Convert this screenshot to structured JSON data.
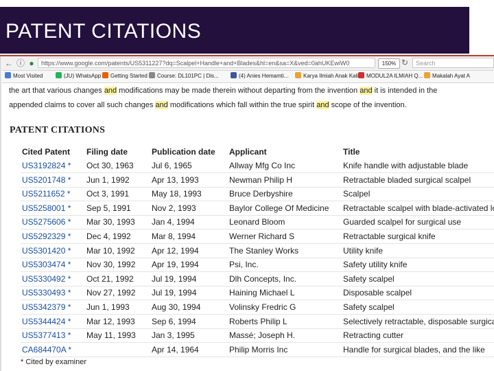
{
  "slide": {
    "title": "PATENT CITATIONS"
  },
  "browser": {
    "url": "https://www.google.com/patents/US5311227?dq=Scalpel+Handle+and+Blades&hl=en&sa=X&ved=0ahUKEwiW0",
    "zoom": "150%",
    "search_placeholder": "Search",
    "bookmarks": [
      {
        "label": "Most Visited",
        "icon_color": "#4a7bd0"
      },
      {
        "label": "(JU) WhatsApp",
        "icon_color": "#25b35a"
      },
      {
        "label": "Getting Started",
        "icon_color": "#e66000"
      },
      {
        "label": "Course: DL101PC | Dis...",
        "icon_color": "#888888"
      },
      {
        "label": "(4) Anies Hemamti...",
        "icon_color": "#3b5998"
      },
      {
        "label": "Karya Ilmiah Anak Kali...",
        "icon_color": "#f0a030"
      },
      {
        "label": "MODUL2A ILMIAH Q...",
        "icon_color": "#d03030"
      },
      {
        "label": "Makalah Ayat A",
        "icon_color": "#f0a030"
      }
    ]
  },
  "paragraph": {
    "line1_a": "the art that various changes ",
    "and1": "and",
    "line1_b": " modifications may be made therein without departing from the invention ",
    "and2": "and",
    "line1_c": " it is intended in the",
    "line2_a": "appended claims to cover all such changes ",
    "and3": "and",
    "line2_b": " modifications which fall within the true spirit ",
    "and4": "and",
    "line2_c": " scope of the invention."
  },
  "section_heading": "PATENT CITATIONS",
  "table": {
    "headers": {
      "cited": "Cited Patent",
      "filing": "Filing date",
      "publication": "Publication date",
      "applicant": "Applicant",
      "title": "Title"
    },
    "rows": [
      {
        "cited": "US3192824 *",
        "filing": "Oct 30, 1963",
        "publication": "Jul 6, 1965",
        "applicant": "Allway Mfg Co Inc",
        "title": "Knife handle with adjustable blade"
      },
      {
        "cited": "US5201748 *",
        "filing": "Jun 1, 1992",
        "publication": "Apr 13, 1993",
        "applicant": "Newman Philip H",
        "title": "Retractable bladed surgical scalpel"
      },
      {
        "cited": "US5211652 *",
        "filing": "Oct 3, 1991",
        "publication": "May 18, 1993",
        "applicant": "Bruce Derbyshire",
        "title": "Scalpel"
      },
      {
        "cited": "US5258001 *",
        "filing": "Sep 5, 1991",
        "publication": "Nov 2, 1993",
        "applicant": "Baylor College Of Medicine",
        "title": "Retractable scalpel with blade-activated lock"
      },
      {
        "cited": "US5275606 *",
        "filing": "Mar 30, 1993",
        "publication": "Jan 4, 1994",
        "applicant": "Leonard Bloom",
        "title": "Guarded scalpel for surgical use"
      },
      {
        "cited": "US5292329 *",
        "filing": "Dec 4, 1992",
        "publication": "Mar 8, 1994",
        "applicant": "Werner Richard S",
        "title": "Retractable surgical knife"
      },
      {
        "cited": "US5301420 *",
        "filing": "Mar 10, 1992",
        "publication": "Apr 12, 1994",
        "applicant": "The Stanley Works",
        "title": "Utility knife"
      },
      {
        "cited": "US5303474 *",
        "filing": "Nov 30, 1992",
        "publication": "Apr 19, 1994",
        "applicant": "Psi, Inc.",
        "title": "Safety utility knife"
      },
      {
        "cited": "US5330492 *",
        "filing": "Oct 21, 1992",
        "publication": "Jul 19, 1994",
        "applicant": "Dlh Concepts, Inc.",
        "title": "Safety scalpel"
      },
      {
        "cited": "US5330493 *",
        "filing": "Nov 27, 1992",
        "publication": "Jul 19, 1994",
        "applicant": "Haining Michael L",
        "title": "Disposable scalpel"
      },
      {
        "cited": "US5342379 *",
        "filing": "Jun 1, 1993",
        "publication": "Aug 30, 1994",
        "applicant": "Volinsky Fredric G",
        "title": "Safety scalpel"
      },
      {
        "cited": "US5344424 *",
        "filing": "Mar 12, 1993",
        "publication": "Sep 6, 1994",
        "applicant": "Roberts Philip L",
        "title": "Selectively retractable, disposable surgical knife"
      },
      {
        "cited": "US5377413 *",
        "filing": "May 11, 1993",
        "publication": "Jan 3, 1995",
        "applicant": "Massé; Joseph H.",
        "title": "Retracting cutter"
      },
      {
        "cited": "CA684470A *",
        "filing": "",
        "publication": "Apr 14, 1964",
        "applicant": "Philip Morris Inc",
        "title": "Handle for surgical blades, and the like"
      }
    ]
  },
  "footnote": "* Cited by examiner",
  "colors": {
    "title_bar": "#23103d",
    "accent_line": "#c0392b",
    "link": "#1a4fa0",
    "highlight": "#fcf3a0"
  }
}
